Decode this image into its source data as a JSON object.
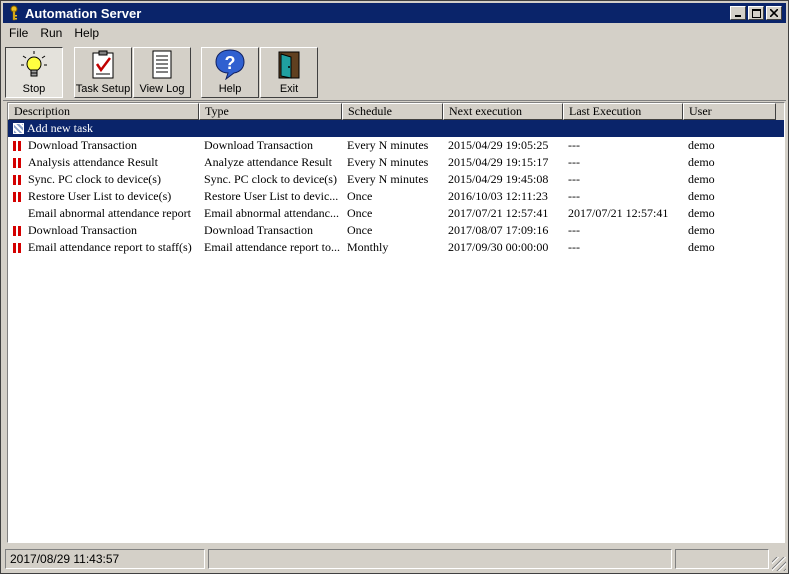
{
  "window": {
    "title": "Automation Server"
  },
  "menu": [
    "File",
    "Run",
    "Help"
  ],
  "toolbar": {
    "stop": "Stop",
    "task_setup": "Task Setup",
    "view_log": "View Log",
    "help": "Help",
    "exit": "Exit"
  },
  "table": {
    "headers": [
      "Description",
      "Type",
      "Schedule",
      "Next execution",
      "Last Execution",
      "User"
    ],
    "add_new": "Add new task",
    "rows": [
      {
        "desc": "Download Transaction",
        "type": "Download Transaction",
        "schedule": "Every N minutes",
        "next": "2015/04/29 19:05:25",
        "last": "---",
        "user": "demo",
        "paused": true
      },
      {
        "desc": "Analysis attendance Result",
        "type": "Analyze attendance Result",
        "schedule": "Every N minutes",
        "next": "2015/04/29 19:15:17",
        "last": "---",
        "user": "demo",
        "paused": true
      },
      {
        "desc": "Sync. PC clock to device(s)",
        "type": "Sync. PC clock to device(s)",
        "schedule": "Every N minutes",
        "next": "2015/04/29 19:45:08",
        "last": "---",
        "user": "demo",
        "paused": true
      },
      {
        "desc": "Restore User List to device(s)",
        "type": "Restore User List to devic...",
        "schedule": "Once",
        "next": "2016/10/03 12:11:23",
        "last": "---",
        "user": "demo",
        "paused": true
      },
      {
        "desc": "Email abnormal attendance report",
        "type": "Email abnormal attendanc...",
        "schedule": "Once",
        "next": "2017/07/21 12:57:41",
        "last": "2017/07/21 12:57:41",
        "user": "demo",
        "paused": false
      },
      {
        "desc": "Download Transaction",
        "type": "Download Transaction",
        "schedule": "Once",
        "next": "2017/08/07 17:09:16",
        "last": "---",
        "user": "demo",
        "paused": true
      },
      {
        "desc": "Email attendance report to staff(s)",
        "type": "Email attendance report to...",
        "schedule": "Monthly",
        "next": "2017/09/30 00:00:00",
        "last": "---",
        "user": "demo",
        "paused": true
      }
    ]
  },
  "status": {
    "datetime": "2017/08/29 11:43:57"
  },
  "colors": {
    "title_bar": "#0a246a",
    "selection": "#0a246a",
    "paused_icon": "#d40000",
    "face": "#d4d0c8"
  }
}
